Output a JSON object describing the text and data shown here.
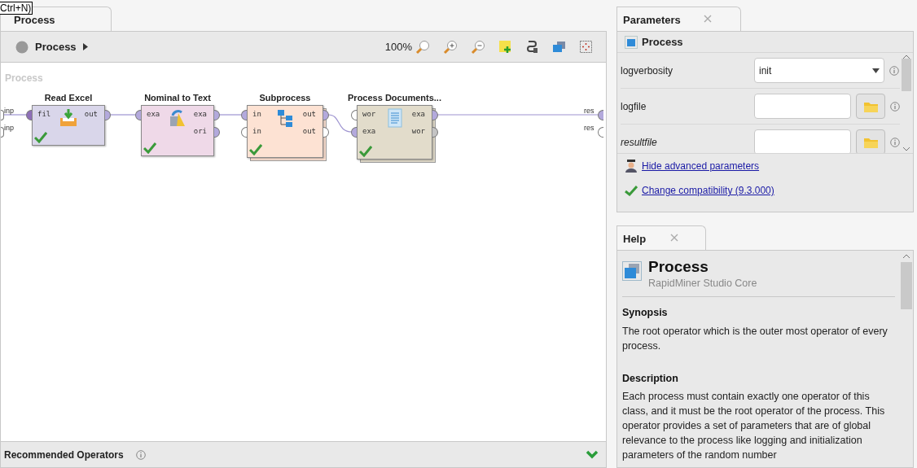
{
  "tooltip": "Ctrl+N)",
  "process_tab": {
    "label": "Process",
    "selected": true
  },
  "breadcrumb": {
    "label": "Process"
  },
  "zoom": "100%",
  "canvas_title": "Process",
  "process_inputs": [
    {
      "label": "inp",
      "color": "#ffffff"
    },
    {
      "label": "inp",
      "color": "#ffffff"
    }
  ],
  "process_outputs": [
    {
      "label": "res",
      "color": "#b3a9dc"
    },
    {
      "label": "res",
      "color": "#ffffff"
    }
  ],
  "operators": [
    {
      "name": "Read Excel",
      "color": "#d9d6ea",
      "stacked": false,
      "valid": true,
      "inputs": [
        {
          "label": "fil",
          "color": "#8e6fb8"
        }
      ],
      "outputs": [
        {
          "label": "out",
          "color": "#b3a9dc"
        }
      ]
    },
    {
      "name": "Nominal to Text",
      "color": "#efd9e8",
      "stacked": false,
      "valid": true,
      "inputs": [
        {
          "label": "exa",
          "color": "#b3a9dc"
        }
      ],
      "outputs": [
        {
          "label": "exa",
          "color": "#b3a9dc"
        },
        {
          "label": "ori",
          "color": "#b3a9dc"
        }
      ]
    },
    {
      "name": "Subprocess",
      "color": "#fde2d3",
      "stacked": true,
      "valid": true,
      "inputs": [
        {
          "label": "in",
          "color": "#b3a9dc"
        },
        {
          "label": "in",
          "color": "#ffffff"
        }
      ],
      "outputs": [
        {
          "label": "out",
          "color": "#b3a9dc"
        },
        {
          "label": "out",
          "color": "#ffffff"
        }
      ]
    },
    {
      "name": "Process Documents...",
      "color": "#e2dccb",
      "stacked": true,
      "valid": true,
      "inputs": [
        {
          "label": "wor",
          "color": "#ffffff"
        },
        {
          "label": "exa",
          "color": "#b3a9dc"
        }
      ],
      "outputs": [
        {
          "label": "exa",
          "color": "#b3a9dc"
        },
        {
          "label": "wor",
          "color": "#c4c4c4"
        }
      ]
    }
  ],
  "recommended": {
    "label": "Recommended Operators"
  },
  "parameters_panel": {
    "tab": "Parameters",
    "operator": "Process",
    "rows": [
      {
        "label": "logverbosity",
        "kind": "select",
        "value": "init",
        "italic": false
      },
      {
        "label": "logfile",
        "kind": "file",
        "italic": false
      },
      {
        "label": "resultfile",
        "kind": "file",
        "italic": true
      }
    ],
    "links": [
      "Hide advanced parameters",
      "Change compatibility (9.3.000)"
    ]
  },
  "help_panel": {
    "tab": "Help",
    "title": "Process",
    "subtitle": "RapidMiner Studio Core",
    "sections": [
      {
        "heading": "Synopsis",
        "text": "The root operator which is the outer most operator of every process."
      },
      {
        "heading": "Description",
        "text": "Each process must contain exactly one operator of this class, and it must be the root operator of the process. This operator provides a set of parameters that are of global relevance to the process like logging and initialization parameters of the random number"
      }
    ]
  }
}
